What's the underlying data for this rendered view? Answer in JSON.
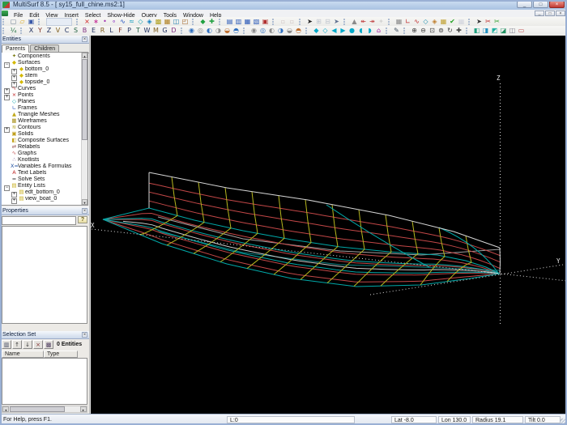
{
  "window": {
    "title": "MultiSurf 8.5 - [ sy15_full_chine.ms2:1]",
    "controls": {
      "minimize": "_",
      "restore": "□",
      "close": "×"
    }
  },
  "menu": {
    "items": [
      "File",
      "Edit",
      "View",
      "Insert",
      "Select",
      "Show-Hide",
      "Query",
      "Tools",
      "Window",
      "Help"
    ]
  },
  "toolbar_row1": [
    [
      {
        "n": "new-file-icon",
        "g": "▢",
        "c": "#6a7a90"
      },
      {
        "n": "open-file-icon",
        "g": "▱",
        "c": "#d8a820"
      },
      {
        "n": "save-icon",
        "g": "▣",
        "c": "#3858a8"
      }
    ],
    [
      {
        "n": "recent-file-box",
        "box": true
      }
    ],
    [
      {
        "n": "delete-entity-icon",
        "g": "×",
        "c": "#d02020"
      },
      {
        "n": "insert-point-icon",
        "g": "∗",
        "c": "#c02090"
      },
      {
        "n": "insert-bead-icon",
        "g": "•",
        "c": "#a030b0"
      },
      {
        "n": "insert-ring-icon",
        "g": "∘",
        "c": "#8020c0"
      },
      {
        "n": "insert-curve-icon",
        "g": "∿",
        "c": "#2050c0"
      },
      {
        "n": "insert-snake-icon",
        "g": "≈",
        "c": "#20a0c0"
      },
      {
        "n": "insert-surface-icon",
        "g": "◇",
        "c": "#10a0b0"
      },
      {
        "n": "insert-surface2-icon",
        "g": "◈",
        "c": "#1080c0"
      },
      {
        "n": "insert-solid-icon",
        "g": "▩",
        "c": "#b0a020"
      },
      {
        "n": "insert-plane-icon",
        "g": "▦",
        "c": "#b08020"
      },
      {
        "n": "insert-frame-icon",
        "g": "◫",
        "c": "#2080b0"
      },
      {
        "n": "insert-entity-list-icon",
        "g": "◰",
        "c": "#a06020"
      }
    ],
    [
      {
        "n": "project-icon",
        "g": "◆",
        "c": "#20a040"
      },
      {
        "n": "offset-icon",
        "g": "✚",
        "c": "#20a040"
      }
    ],
    [
      {
        "n": "wireframe-view-icon",
        "g": "▤",
        "c": "#2858b8"
      },
      {
        "n": "body-view-icon",
        "g": "▥",
        "c": "#2858b8"
      },
      {
        "n": "plan-view-icon",
        "g": "▦",
        "c": "#2858b8"
      },
      {
        "n": "profile-view-icon",
        "g": "▧",
        "c": "#2858b8"
      },
      {
        "n": "perspective-view-icon",
        "g": "▣",
        "c": "#b03030"
      }
    ],
    [
      {
        "n": "display-opt1-icon",
        "g": "▫",
        "c": "#907070",
        "d": 1
      },
      {
        "n": "display-opt2-icon",
        "g": "▫",
        "c": "#907070",
        "d": 1
      }
    ],
    [
      {
        "n": "select-arrow-icon",
        "g": "➤",
        "c": "#202020"
      },
      {
        "n": "select-add-icon",
        "g": "⊞",
        "c": "#607090",
        "d": 1
      },
      {
        "n": "select-remove-icon",
        "g": "⊟",
        "c": "#607090",
        "d": 1
      },
      {
        "n": "select-all-icon",
        "g": "➤",
        "c": "#607090"
      }
    ],
    [
      {
        "n": "nudge-icon",
        "g": "▲",
        "c": "#8a8a8a"
      },
      {
        "n": "move-aft-icon",
        "g": "↞",
        "c": "#c04040"
      },
      {
        "n": "move-fwd-icon",
        "g": "↠",
        "c": "#c04040"
      },
      {
        "n": "snap-icon",
        "g": "✦",
        "c": "#a0a0a0",
        "d": 1
      }
    ],
    [
      {
        "n": "grid-icon",
        "g": "▦",
        "c": "#8a8a8a"
      },
      {
        "n": "edit-point-icon",
        "g": "∟",
        "c": "#c03030"
      },
      {
        "n": "edit-curve-icon",
        "g": "∿",
        "c": "#c03030"
      },
      {
        "n": "edit-surface-icon",
        "g": "◇",
        "c": "#2090b0"
      },
      {
        "n": "edit-frame-icon",
        "g": "◈",
        "c": "#c08030"
      },
      {
        "n": "edit-mesh-icon",
        "g": "▦",
        "c": "#c0a030"
      },
      {
        "n": "check-model-icon",
        "g": "✔",
        "c": "#20a020"
      },
      {
        "n": "table-icon",
        "g": "▦",
        "c": "#9aa0c0",
        "d": 1
      }
    ],
    [
      {
        "n": "pick-icon",
        "g": "➤",
        "c": "#303030"
      },
      {
        "n": "cut-red-icon",
        "g": "✂",
        "c": "#c03030"
      },
      {
        "n": "cut-green-icon",
        "g": "✂",
        "c": "#30a030"
      }
    ]
  ],
  "toolbar_row2": [
    [
      {
        "n": "snap-fraction-icon",
        "g": "¼",
        "c": "#207040"
      }
    ],
    [
      {
        "n": "entity-type-x-icon",
        "g": "X",
        "c": "#203060"
      },
      {
        "n": "entity-type-y-icon",
        "g": "Y",
        "c": "#803020"
      },
      {
        "n": "entity-type-z-icon",
        "g": "Z",
        "c": "#203060"
      },
      {
        "n": "entity-type-v-icon",
        "g": "V",
        "c": "#806020"
      },
      {
        "n": "entity-type-c-icon",
        "g": "C",
        "c": "#203060"
      },
      {
        "n": "entity-type-s-icon",
        "g": "S",
        "c": "#206040"
      },
      {
        "n": "entity-type-b-icon",
        "g": "B",
        "c": "#803080"
      },
      {
        "n": "entity-type-e-icon",
        "g": "E",
        "c": "#203060"
      },
      {
        "n": "entity-type-r-icon",
        "g": "R",
        "c": "#806020"
      },
      {
        "n": "entity-type-l-icon",
        "g": "L",
        "c": "#203060"
      },
      {
        "n": "entity-type-f-icon",
        "g": "F",
        "c": "#803020"
      },
      {
        "n": "entity-type-p-icon",
        "g": "P",
        "c": "#203060"
      },
      {
        "n": "entity-type-t-icon",
        "g": "T",
        "c": "#206040"
      },
      {
        "n": "entity-type-w-icon",
        "g": "W",
        "c": "#203060"
      },
      {
        "n": "entity-type-m-icon",
        "g": "M",
        "c": "#806020"
      },
      {
        "n": "entity-type-g-icon",
        "g": "G",
        "c": "#203060"
      },
      {
        "n": "entity-type-d-icon",
        "g": "D",
        "c": "#803080"
      }
    ],
    [
      {
        "n": "show-all-icon",
        "g": "◉",
        "c": "#3070c0"
      },
      {
        "n": "hide-all-icon",
        "g": "◎",
        "c": "#8a8a8a"
      },
      {
        "n": "show-selected-icon",
        "g": "◐",
        "c": "#3070c0"
      },
      {
        "n": "hide-selected-icon",
        "g": "◑",
        "c": "#8a8a8a"
      },
      {
        "n": "invert-visibility-icon",
        "g": "◒",
        "c": "#c07030"
      },
      {
        "n": "isolate-icon",
        "g": "◓",
        "c": "#3070c0"
      }
    ],
    [
      {
        "n": "show-points-icon",
        "g": "◉",
        "c": "#8a8a8a"
      },
      {
        "n": "hide-points-icon",
        "g": "◎",
        "c": "#3070c0"
      },
      {
        "n": "show-labels-icon",
        "g": "◐",
        "c": "#8a8a8a"
      },
      {
        "n": "hide-labels-icon",
        "g": "◑",
        "c": "#3070c0"
      },
      {
        "n": "invert-labels-icon",
        "g": "◒",
        "c": "#8a8a8a"
      },
      {
        "n": "isolate-labels-icon",
        "g": "◓",
        "c": "#c07030"
      }
    ],
    [
      {
        "n": "view-bow-icon",
        "g": "◆",
        "c": "#00a8c8"
      },
      {
        "n": "view-stern-icon",
        "g": "◇",
        "c": "#00a8c8"
      },
      {
        "n": "view-port-icon",
        "g": "◀",
        "c": "#00a8c8"
      },
      {
        "n": "view-starboard-icon",
        "g": "▶",
        "c": "#00a8c8"
      },
      {
        "n": "view-top-icon",
        "g": "●",
        "c": "#00a8c8"
      },
      {
        "n": "view-bottom-icon",
        "g": "◖",
        "c": "#00a8c8"
      },
      {
        "n": "view-iso-icon",
        "g": "◗",
        "c": "#00a8c8"
      },
      {
        "n": "home-view-icon",
        "g": "⌂",
        "c": "#a020a0"
      }
    ],
    [
      {
        "n": "measure-icon",
        "g": "✎",
        "c": "#405060"
      }
    ],
    [
      {
        "n": "zoom-in-icon",
        "g": "⊕",
        "c": "#404040"
      },
      {
        "n": "zoom-out-icon",
        "g": "⊖",
        "c": "#404040"
      },
      {
        "n": "zoom-window-icon",
        "g": "⊡",
        "c": "#404040"
      },
      {
        "n": "zoom-fit-icon",
        "g": "⊚",
        "c": "#404040"
      },
      {
        "n": "rotate-view-icon",
        "g": "↻",
        "c": "#404040"
      },
      {
        "n": "pan-view-icon",
        "g": "✚",
        "c": "#404040"
      }
    ],
    [
      {
        "n": "copy-view-icon",
        "g": "◧",
        "c": "#20a080"
      },
      {
        "n": "export-3d-icon",
        "g": "◨",
        "c": "#2090c0"
      },
      {
        "n": "export-model-icon",
        "g": "◩",
        "c": "#20b0a0"
      },
      {
        "n": "import-icon",
        "g": "◪",
        "c": "#209060"
      },
      {
        "n": "render-icon",
        "g": "◫",
        "c": "#80808f"
      },
      {
        "n": "report-icon",
        "g": "▭",
        "c": "#c05050"
      }
    ]
  ],
  "entities_panel": {
    "title": "Entities",
    "close": "×",
    "tabs": [
      {
        "label": "Parents"
      },
      {
        "label": "Children"
      }
    ],
    "tree": [
      {
        "label": "Components",
        "icon": "components-icon",
        "glyph": "✦",
        "color": "#7a7a10",
        "depth": 0,
        "toggle": ""
      },
      {
        "label": "Surfaces",
        "icon": "surfaces-icon",
        "glyph": "◆",
        "color": "#d4b800",
        "depth": 0,
        "toggle": "-"
      },
      {
        "label": "bottom_0",
        "icon": "surface-icon",
        "glyph": "◆",
        "color": "#d4b800",
        "depth": 1,
        "toggle": "+"
      },
      {
        "label": "stem",
        "icon": "surface-icon",
        "glyph": "◆",
        "color": "#d4b800",
        "depth": 1,
        "toggle": "+"
      },
      {
        "label": "topside_0",
        "icon": "surface-icon",
        "glyph": "◆",
        "color": "#d4b800",
        "depth": 1,
        "toggle": "+"
      },
      {
        "label": "Curves",
        "icon": "curves-icon",
        "glyph": "∿",
        "color": "#b03030",
        "depth": 0,
        "toggle": "+"
      },
      {
        "label": "Points",
        "icon": "points-icon",
        "glyph": "×",
        "color": "#c02020",
        "depth": 0,
        "toggle": "+"
      },
      {
        "label": "Planes",
        "icon": "planes-icon",
        "glyph": "◇",
        "color": "#00a0a8",
        "depth": 0,
        "toggle": ""
      },
      {
        "label": "Frames",
        "icon": "frames-icon",
        "glyph": "∟",
        "color": "#3060c0",
        "depth": 0,
        "toggle": ""
      },
      {
        "label": "Triangle Meshes",
        "icon": "tri-mesh-icon",
        "glyph": "▲",
        "color": "#c0a818",
        "depth": 0,
        "toggle": ""
      },
      {
        "label": "Wireframes",
        "icon": "wireframes-icon",
        "glyph": "▦",
        "color": "#a89018",
        "depth": 0,
        "toggle": ""
      },
      {
        "label": "Contours",
        "icon": "contours-icon",
        "glyph": "≋",
        "color": "#b0a020",
        "depth": 0,
        "toggle": "+"
      },
      {
        "label": "Solids",
        "icon": "solids-icon",
        "glyph": "▣",
        "color": "#c0a020",
        "depth": 0,
        "toggle": ""
      },
      {
        "label": "Composite Surfaces",
        "icon": "composite-surfaces-icon",
        "glyph": "◧",
        "color": "#c8a828",
        "depth": 0,
        "toggle": ""
      },
      {
        "label": "Relabels",
        "icon": "relabels-icon",
        "glyph": "⇄",
        "color": "#a06060",
        "depth": 0,
        "toggle": ""
      },
      {
        "label": "Graphs",
        "icon": "graphs-icon",
        "glyph": "∿",
        "color": "#c05050",
        "depth": 0,
        "toggle": ""
      },
      {
        "label": "Knotlists",
        "icon": "knotlists-icon",
        "glyph": "∴",
        "color": "#705090",
        "depth": 0,
        "toggle": ""
      },
      {
        "label": "Variables & Formulas",
        "icon": "variables-icon",
        "glyph": "X=",
        "color": "#2050a0",
        "depth": 0,
        "toggle": ""
      },
      {
        "label": "Text Labels",
        "icon": "text-labels-icon",
        "glyph": "A",
        "color": "#c03030",
        "depth": 0,
        "toggle": ""
      },
      {
        "label": "Solve Sets",
        "icon": "solve-sets-icon",
        "glyph": "=",
        "color": "#303030",
        "depth": 0,
        "toggle": ""
      },
      {
        "label": "Entity Lists",
        "icon": "entity-lists-icon",
        "glyph": "▤",
        "color": "#c8b020",
        "depth": 0,
        "toggle": "-"
      },
      {
        "label": "edt_bottom_0",
        "icon": "entity-list-icon",
        "glyph": "▤",
        "color": "#c8b020",
        "depth": 1,
        "toggle": "+"
      },
      {
        "label": "view_boat_0",
        "icon": "entity-list-icon",
        "glyph": "▤",
        "color": "#c8b020",
        "depth": 1,
        "toggle": "+"
      }
    ]
  },
  "properties_panel": {
    "title": "Properties",
    "close": "×",
    "help_icon": "?"
  },
  "selection_panel": {
    "title": "Selection Set",
    "close": "×",
    "buttons": [
      {
        "n": "selection-list-icon",
        "g": "▥",
        "c": "#404860"
      },
      {
        "n": "move-up-icon",
        "g": "↑",
        "c": "#303030"
      },
      {
        "n": "move-down-icon",
        "g": "↓",
        "c": "#303030"
      },
      {
        "n": "remove-from-set-icon",
        "g": "×",
        "c": "#803030"
      },
      {
        "n": "clear-set-icon",
        "g": "▩",
        "c": "#504060"
      }
    ],
    "count": "0 Entities",
    "columns": [
      "Name",
      "Type"
    ]
  },
  "viewport": {
    "labels": {
      "x": "X",
      "y": "Y",
      "z": "Z"
    },
    "colors": {
      "bg": "#000000",
      "outline": "#d6d6d6",
      "far": "#a0a0a0",
      "red": "#c24747",
      "yellow": "#b6b61e",
      "cyan": "#00a8a8",
      "cyan_dim": "#0a8080",
      "white_line": "#c8c8c8",
      "axis": "#dcdcdc"
    }
  },
  "status_bar": {
    "help": "For Help, press F1.",
    "cells": [
      "L:0",
      "Lat -8.0",
      "Lon 130.0",
      "Radius 19.1",
      "Tilt 0.0"
    ]
  }
}
